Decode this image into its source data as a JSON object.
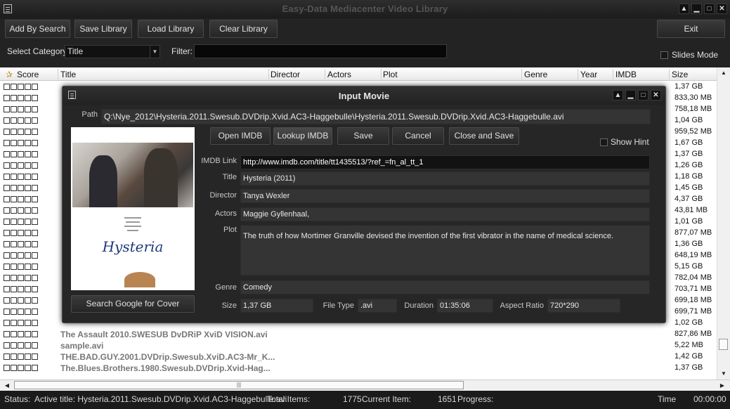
{
  "window": {
    "title": "Easy-Data Mediacenter Video Library"
  },
  "toolbar": {
    "add_by_search": "Add By Search",
    "save_library": "Save Library",
    "load_library": "Load Library",
    "clear_library": "Clear Library",
    "exit": "Exit",
    "select_category_label": "Select Category",
    "category_value": "Title",
    "filter_label": "Filter:",
    "slides_mode_label": "Slides Mode"
  },
  "grid": {
    "columns": [
      "Score",
      "Title",
      "Director",
      "Actors",
      "Plot",
      "Genre",
      "Year",
      "IMDB",
      "Size"
    ],
    "rows": [
      {
        "title": "",
        "size": "1,37 GB"
      },
      {
        "title": "",
        "size": "833,30 MB"
      },
      {
        "title": "",
        "size": "758,18 MB"
      },
      {
        "title": "",
        "size": "1,04 GB"
      },
      {
        "title": "",
        "size": "959,52 MB"
      },
      {
        "title": "",
        "size": "1,67 GB"
      },
      {
        "title": "",
        "size": "1,37 GB"
      },
      {
        "title": "",
        "size": "1,26 GB"
      },
      {
        "title": "",
        "size": "1,18 GB"
      },
      {
        "title": "",
        "size": "1,45 GB"
      },
      {
        "title": "",
        "size": "4,37 GB"
      },
      {
        "title": "",
        "size": "43,81 MB"
      },
      {
        "title": "",
        "size": "1,01 GB"
      },
      {
        "title": "",
        "size": "877,07 MB"
      },
      {
        "title": "",
        "size": "1,36 GB"
      },
      {
        "title": "",
        "size": "648,19 MB"
      },
      {
        "title": "",
        "size": "5,15 GB"
      },
      {
        "title": "",
        "size": "782,04 MB"
      },
      {
        "title": "",
        "size": "703,71 MB"
      },
      {
        "title": "",
        "size": "699,18 MB"
      },
      {
        "title": "",
        "size": "699,71 MB"
      },
      {
        "title": "",
        "size": "1,02 GB"
      },
      {
        "title": "The Assault 2010.SWESUB DvDRiP XviD VISION.avi",
        "size": "827,86 MB"
      },
      {
        "title": "sample.avi",
        "size": "5,22 MB"
      },
      {
        "title": "THE.BAD.GUY.2001.DVDrip.Swesub.XviD.AC3-Mr_K...",
        "size": "1,42 GB"
      },
      {
        "title": "The.Blues.Brothers.1980.Swesub.DVDrip.Xvid-Hag...",
        "size": "1,37 GB"
      }
    ]
  },
  "status": {
    "label": "Status:",
    "active_title": "Active title: Hysteria.2011.Swesub.DVDrip.Xvid.AC3-Haggebulle.avi",
    "total_items_label": "Total Items:",
    "total_items": "1775",
    "current_item_label": "Current Item:",
    "current_item": "1651",
    "progress_label": "Progress:",
    "time_label": "Time",
    "time_value": "00:00:00"
  },
  "dialog": {
    "title": "Input Movie",
    "path_label": "Path",
    "path": "Q:\\Nye_2012\\Hysteria.2011.Swesub.DVDrip.Xvid.AC3-Haggebulle\\Hysteria.2011.Swesub.DVDrip.Xvid.AC3-Haggebulle.avi",
    "buttons": {
      "open_imdb": "Open IMDB",
      "lookup_imdb": "Lookup IMDB",
      "save": "Save",
      "cancel": "Cancel",
      "close_and_save": "Close and Save"
    },
    "show_hint_label": "Show Hint",
    "imdb_link_label": "IMDB Link",
    "imdb_link": "http://www.imdb.com/title/tt1435513/?ref_=fn_al_tt_1",
    "title_label": "Title",
    "title_value": "Hysteria (2011)",
    "director_label": "Director",
    "director_value": "Tanya Wexler",
    "actors_label": "Actors",
    "actors_value": "Maggie Gyllenhaal,",
    "plot_label": "Plot",
    "plot_value": "The truth of how Mortimer Granville devised the invention of the first vibrator in the name of medical science.",
    "genre_label": "Genre",
    "genre_value": "Comedy",
    "size_label": "Size",
    "size_value": "1,37 GB",
    "filetype_label": "File Type",
    "filetype_value": ".avi",
    "duration_label": "Duration",
    "duration_value": "01:35:06",
    "aspect_label": "Aspect Ratio",
    "aspect_value": "720*290",
    "search_cover_button": "Search Google for  Cover",
    "poster_title": "Hysteria"
  }
}
